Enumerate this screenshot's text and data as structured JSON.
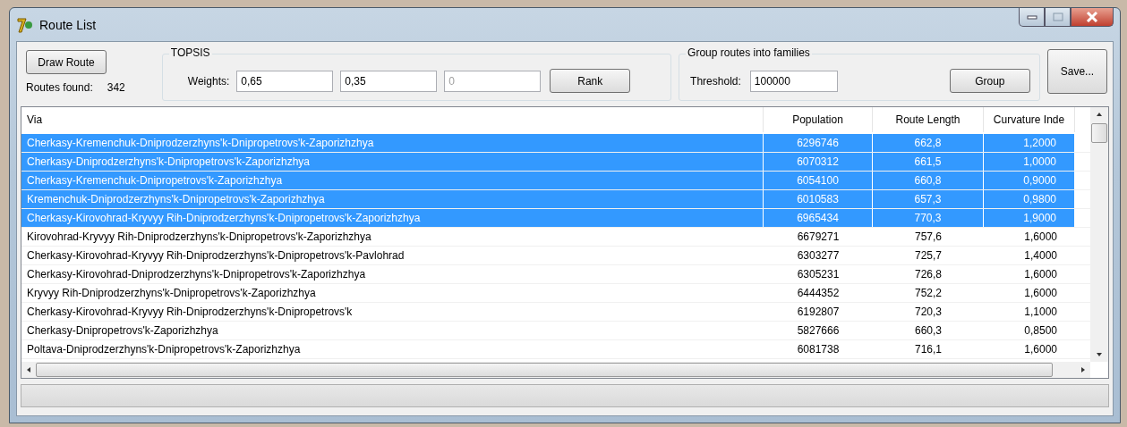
{
  "window": {
    "title": "Route List"
  },
  "draw_button": "Draw Route",
  "routes_found": {
    "label": "Routes found:",
    "value": "342"
  },
  "topsis": {
    "title": "TOPSIS",
    "weights_label": "Weights:",
    "weights": [
      {
        "value": "0,65"
      },
      {
        "value": "0,35"
      },
      {
        "placeholder": "0"
      }
    ],
    "rank_button": "Rank"
  },
  "grouping": {
    "title": "Group routes into families",
    "threshold_label": "Threshold:",
    "threshold": "100000",
    "group_button": "Group"
  },
  "save_button": "Save...",
  "table": {
    "columns": [
      "Via",
      "Population",
      "Route Length",
      "Curvature Inde"
    ],
    "rows": [
      {
        "cells": [
          "Cherkasy-Kremenchuk-Dniprodzerzhyns'k-Dnipropetrovs'k-Zaporizhzhya",
          "6296746",
          "662,8",
          "1,2000"
        ],
        "selected": true
      },
      {
        "cells": [
          "Cherkasy-Dniprodzerzhyns'k-Dnipropetrovs'k-Zaporizhzhya",
          "6070312",
          "661,5",
          "1,0000"
        ],
        "selected": true
      },
      {
        "cells": [
          "Cherkasy-Kremenchuk-Dnipropetrovs'k-Zaporizhzhya",
          "6054100",
          "660,8",
          "0,9000"
        ],
        "selected": true
      },
      {
        "cells": [
          "Kremenchuk-Dniprodzerzhyns'k-Dnipropetrovs'k-Zaporizhzhya",
          "6010583",
          "657,3",
          "0,9800"
        ],
        "selected": true
      },
      {
        "cells": [
          "Cherkasy-Kirovohrad-Kryvyy Rih-Dniprodzerzhyns'k-Dnipropetrovs'k-Zaporizhzhya",
          "6965434",
          "770,3",
          "1,9000"
        ],
        "selected": true
      },
      {
        "cells": [
          "Kirovohrad-Kryvyy Rih-Dniprodzerzhyns'k-Dnipropetrovs'k-Zaporizhzhya",
          "6679271",
          "757,6",
          "1,6000"
        ],
        "selected": false
      },
      {
        "cells": [
          "Cherkasy-Kirovohrad-Kryvyy Rih-Dniprodzerzhyns'k-Dnipropetrovs'k-Pavlohrad",
          "6303277",
          "725,7",
          "1,4000"
        ],
        "selected": false
      },
      {
        "cells": [
          "Cherkasy-Kirovohrad-Dniprodzerzhyns'k-Dnipropetrovs'k-Zaporizhzhya",
          "6305231",
          "726,8",
          "1,6000"
        ],
        "selected": false
      },
      {
        "cells": [
          "Kryvyy Rih-Dniprodzerzhyns'k-Dnipropetrovs'k-Zaporizhzhya",
          "6444352",
          "752,2",
          "1,6000"
        ],
        "selected": false
      },
      {
        "cells": [
          "Cherkasy-Kirovohrad-Kryvyy Rih-Dniprodzerzhyns'k-Dnipropetrovs'k",
          "6192807",
          "720,3",
          "1,1000"
        ],
        "selected": false
      },
      {
        "cells": [
          "Cherkasy-Dnipropetrovs'k-Zaporizhzhya",
          "5827666",
          "660,3",
          "0,8500"
        ],
        "selected": false
      },
      {
        "cells": [
          "Poltava-Dniprodzerzhyns'k-Dnipropetrovs'k-Zaporizhzhya",
          "6081738",
          "716,1",
          "1,6000"
        ],
        "selected": false
      }
    ]
  }
}
